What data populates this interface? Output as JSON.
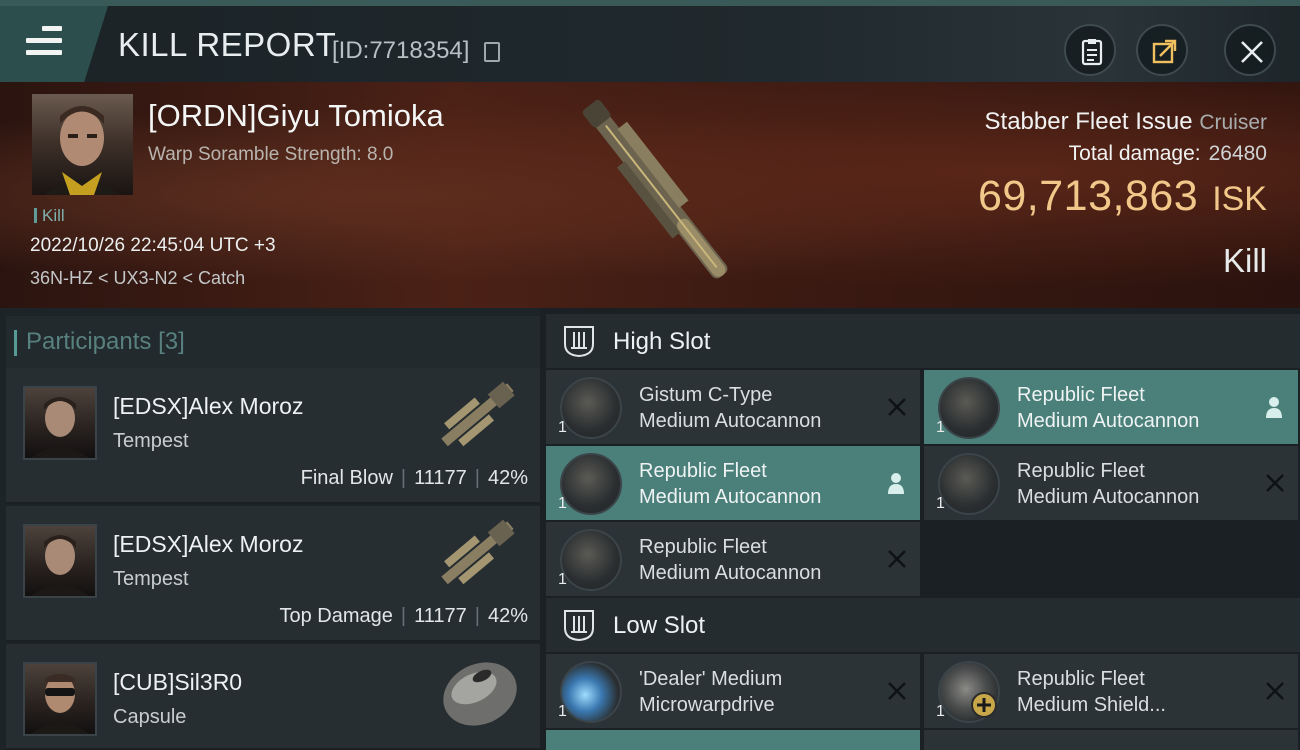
{
  "header": {
    "title": "KILL REPORT",
    "report_id": "[ID:7718354]"
  },
  "victim": {
    "name": "[ORDN]Giyu Tomioka",
    "stat": "Warp Soramble Strength: 8.0",
    "tag": "Kill",
    "datetime": "2022/10/26 22:45:04 UTC +3",
    "location": "36N-HZ < UX3-N2 < Catch",
    "ship": "Stabber Fleet Issue",
    "ship_class": "Cruiser",
    "total_damage_label": "Total damage:",
    "total_damage": "26480",
    "isk_value": "69,713,863",
    "isk_unit": "ISK",
    "kill_type": "Kill"
  },
  "participants": {
    "title": "Participants",
    "count": "[3]",
    "items": [
      {
        "name": "[EDSX]Alex Moroz",
        "ship": "Tempest",
        "role": "Final Blow",
        "damage": "11177",
        "percent": "42%"
      },
      {
        "name": "[EDSX]Alex Moroz",
        "ship": "Tempest",
        "role": "Top Damage",
        "damage": "11177",
        "percent": "42%"
      },
      {
        "name": "[CUB]Sil3R0",
        "ship": "Capsule"
      }
    ]
  },
  "high_slot": {
    "title": "High Slot",
    "modules": [
      {
        "line1": "Gistum C-Type",
        "line2": "Medium Autocannon",
        "qty": "1",
        "state": "destroyed"
      },
      {
        "line1": "Republic Fleet",
        "line2": "Medium Autocannon",
        "qty": "1",
        "state": "dropped"
      },
      {
        "line1": "Republic Fleet",
        "line2": "Medium Autocannon",
        "qty": "1",
        "state": "dropped"
      },
      {
        "line1": "Republic Fleet",
        "line2": "Medium Autocannon",
        "qty": "1",
        "state": "destroyed"
      },
      {
        "line1": "Republic Fleet",
        "line2": "Medium Autocannon",
        "qty": "1",
        "state": "destroyed"
      }
    ]
  },
  "low_slot": {
    "title": "Low Slot",
    "modules": [
      {
        "line1": "'Dealer' Medium",
        "line2": "Microwarpdrive",
        "qty": "1",
        "state": "destroyed"
      },
      {
        "line1": "Republic Fleet",
        "line2": "Medium Shield...",
        "qty": "1",
        "state": "destroyed"
      }
    ]
  },
  "colors": {
    "accent_teal": "#4b7f7a",
    "isk_gold": "#f2c88a"
  }
}
